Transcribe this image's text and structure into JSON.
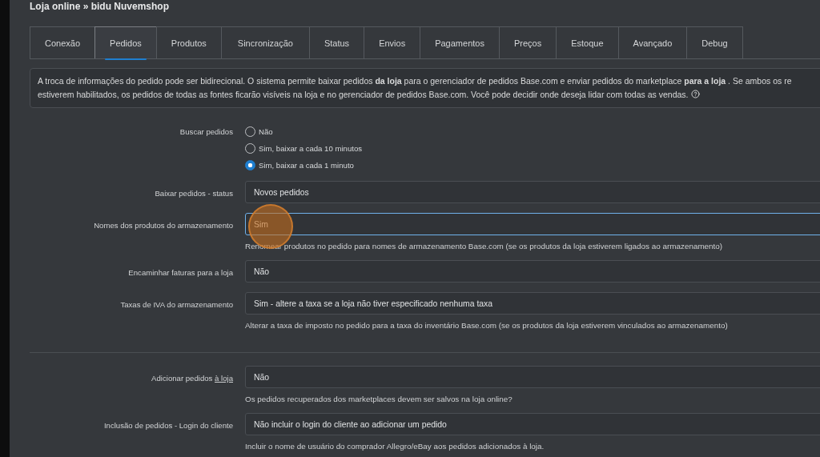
{
  "breadcrumb": "Loja online » bidu Nuvemshop",
  "tabs": [
    {
      "label": "Conexão",
      "selected": false
    },
    {
      "label": "Pedidos",
      "selected": true
    },
    {
      "label": "Produtos",
      "selected": false
    },
    {
      "label": "Sincronização",
      "selected": false
    },
    {
      "label": "Status",
      "selected": false
    },
    {
      "label": "Envios",
      "selected": false
    },
    {
      "label": "Pagamentos",
      "selected": false
    },
    {
      "label": "Preços",
      "selected": false
    },
    {
      "label": "Estoque",
      "selected": false
    },
    {
      "label": "Avançado",
      "selected": false
    },
    {
      "label": "Debug",
      "selected": false
    }
  ],
  "info": {
    "lines": [
      "A troca de informações do pedido pode ser bidirecional. O sistema permite baixar pedidos **da loja** para o gerenciador de pedidos Base.com e enviar pedidos do marketplace **para a loja** . Se ambos os re",
      "estiverem habilitados, os pedidos de todas as fontes ficarão visíveis na loja e no gerenciador de pedidos Base.com. Você pode decidir onde deseja lidar com todas as vendas."
    ]
  },
  "sections": [
    {
      "fields": [
        {
          "kind": "radio",
          "label": "Buscar pedidos",
          "options": [
            {
              "label": "Não",
              "selected": false
            },
            {
              "label": "Sim, baixar a cada 10 minutos",
              "selected": false
            },
            {
              "label": "Sim, baixar a cada 1 minuto",
              "selected": true
            }
          ]
        },
        {
          "kind": "select",
          "label": "Baixar pedidos - status",
          "value": "Novos pedidos",
          "focused": false
        },
        {
          "kind": "select",
          "label": "Nomes dos produtos do armazenamento",
          "value": "Sim",
          "focused": true,
          "help": "Renomear produtos no pedido para nomes de armazenamento Base.com (se os produtos da loja estiverem ligados ao armazenamento)"
        },
        {
          "kind": "select",
          "label": "Encaminhar faturas para a loja",
          "value": "Não",
          "focused": false
        },
        {
          "kind": "select",
          "label": "Taxas de IVA do armazenamento",
          "value": "Sim - altere a taxa se a loja não tiver especificado nenhuma taxa",
          "focused": false,
          "help": "Alterar a taxa de imposto no pedido para a taxa do inventário Base.com (se os produtos da loja estiverem vinculados ao armazenamento)"
        }
      ]
    },
    {
      "fields": [
        {
          "kind": "select",
          "label": "Adicionar pedidos",
          "label_link": "à loja",
          "value": "Não",
          "focused": false,
          "help": "Os pedidos recuperados dos marketplaces devem ser salvos na loja online?"
        },
        {
          "kind": "select",
          "label": "Inclusão de pedidos - Login do cliente",
          "value": "Não incluir o login do cliente ao adicionar um pedido",
          "focused": false,
          "help": "Incluir o nome de usuário do comprador Allegro/eBay aos pedidos adicionados à loja."
        }
      ]
    }
  ]
}
